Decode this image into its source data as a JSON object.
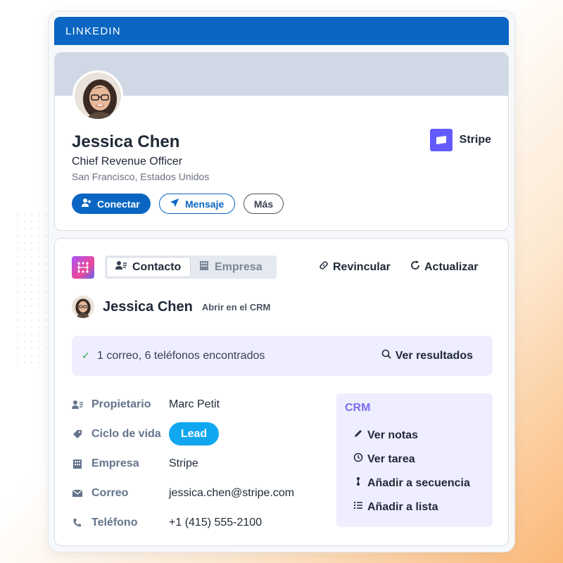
{
  "header": {
    "label": "LINKEDIN",
    "color": "#0a66c2"
  },
  "profile": {
    "name": "Jessica Chen",
    "title": "Chief Revenue Officer",
    "location": "San Francisco, Estados Unidos",
    "company": "Stripe",
    "buttons": {
      "connect": "Conectar",
      "message": "Mensaje",
      "more": "Más"
    }
  },
  "crm": {
    "tabs": {
      "contact": "Contacto",
      "company": "Empresa"
    },
    "actions": {
      "relink": "Revincular",
      "refresh": "Actualizar"
    },
    "contact": {
      "name": "Jessica Chen",
      "open_crm": "Abrir en el CRM"
    },
    "found": {
      "text": "1 correo, 6 teléfonos encontrados",
      "link": "Ver resultados"
    },
    "fields": [
      {
        "label": "Propietario",
        "value": "Marc Petit",
        "icon": "owner-icon"
      },
      {
        "label": "Ciclo de vida",
        "value": "Lead",
        "icon": "tag-icon"
      },
      {
        "label": "Empresa",
        "value": "Stripe",
        "icon": "building-icon"
      },
      {
        "label": "Correo",
        "value": "jessica.chen@stripe.com",
        "icon": "mail-icon"
      },
      {
        "label": "Teléfono",
        "value": "+1 (415) 555-2100",
        "icon": "phone-icon"
      }
    ],
    "panel": {
      "title": "CRM",
      "items": [
        "Ver notas",
        "Ver tarea",
        "Añadir a secuencia",
        "Añadir a lista"
      ]
    }
  }
}
